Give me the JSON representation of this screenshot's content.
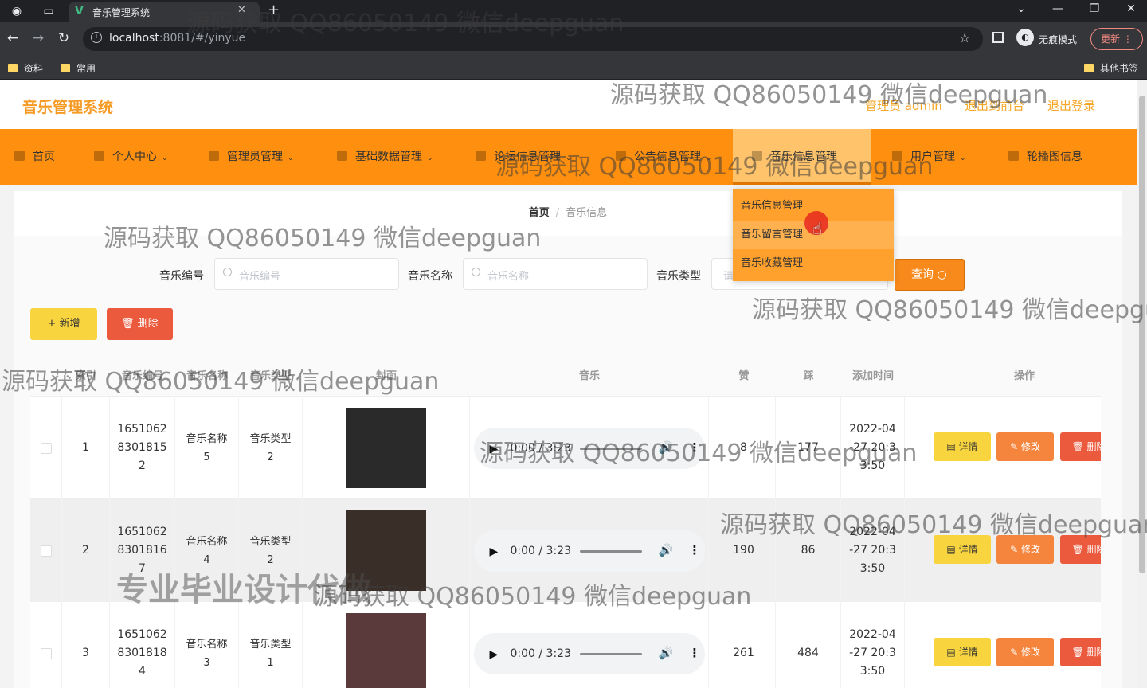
{
  "browser": {
    "tab_title": "音乐管理系统",
    "url_host": "localhost",
    "url_rest": ":8081/#/yinyue",
    "incognito_label": "无痕模式",
    "update_label": "更新",
    "bookmarks": [
      "资料",
      "常用"
    ],
    "other_bookmarks": "其他书签"
  },
  "header": {
    "logo": "音乐管理系统",
    "links": [
      "管理员 admin",
      "退出到前台",
      "退出登录"
    ]
  },
  "menu": {
    "items": [
      "首页",
      "个人中心",
      "管理员管理",
      "基础数据管理",
      "论坛信息管理",
      "公告信息管理",
      "音乐信息管理",
      "用户管理",
      "轮播图信息"
    ],
    "dropdown": [
      "音乐信息管理",
      "音乐留言管理",
      "音乐收藏管理"
    ]
  },
  "breadcrumb": {
    "home": "首页",
    "sep": "/",
    "current": "音乐信息"
  },
  "search": {
    "fields": [
      {
        "label": "音乐编号",
        "placeholder": "音乐编号"
      },
      {
        "label": "音乐名称",
        "placeholder": "音乐名称"
      },
      {
        "label": "音乐类型",
        "placeholder": "请"
      }
    ],
    "query_label": "查询 ○"
  },
  "toolbar": {
    "add_label": "+ 新增",
    "delete_label": "🗑 删除"
  },
  "table": {
    "headers": [
      "索引",
      "音乐编号",
      "音乐名称",
      "音乐类型",
      "封面",
      "音乐",
      "赞",
      "踩",
      "添加时间",
      "操作"
    ],
    "actions": {
      "detail": "▤ 详情",
      "edit": "✎ 修改",
      "delete": "🗑 删除"
    },
    "rows": [
      {
        "index": "1",
        "code": "1651062\n8301815\n2",
        "name": "音乐名称\n5",
        "type": "音乐类型\n2",
        "time_display": "0:00 / 3:23",
        "likes": "8",
        "dislikes": "177",
        "added": "2022-04\n-27 20:3\n3:50",
        "cover_color": "#2a2a2a"
      },
      {
        "index": "2",
        "code": "1651062\n8301816\n7",
        "name": "音乐名称\n4",
        "type": "音乐类型\n2",
        "time_display": "0:00 / 3:23",
        "likes": "190",
        "dislikes": "86",
        "added": "2022-04\n-27 20:3\n3:50",
        "cover_color": "#3a2e28"
      },
      {
        "index": "3",
        "code": "1651062\n8301818\n4",
        "name": "音乐名称\n3",
        "type": "音乐类型\n1",
        "time_display": "0:00 / 3:23",
        "likes": "261",
        "dislikes": "484",
        "added": "2022-04\n-27 20:3\n3:50",
        "cover_color": "#5a3a3a"
      }
    ]
  },
  "watermarks": [
    "源码获取 QQ86050149 微信deepguan",
    "源码获取 QQ86050149 微信deepgu",
    "专业毕业设计代做"
  ]
}
